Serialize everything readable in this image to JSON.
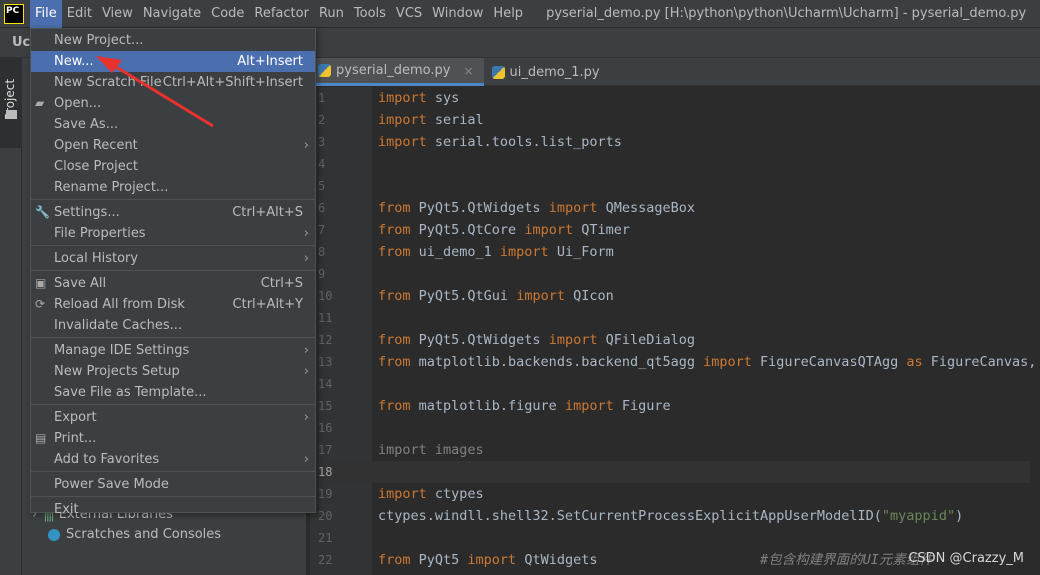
{
  "menubar": {
    "logo": "PC",
    "items": [
      "File",
      "Edit",
      "View",
      "Navigate",
      "Code",
      "Refactor",
      "Run",
      "Tools",
      "VCS",
      "Window",
      "Help"
    ],
    "window_title": "pyserial_demo.py [H:\\python\\python\\Ucharm\\Ucharm] - pyserial_demo.py"
  },
  "toolbar": {
    "project_title": "Uc"
  },
  "strip": {
    "project_tab": "Project"
  },
  "panel": {
    "external_libraries": "External Libraries",
    "scratches": "Scratches and Consoles"
  },
  "file_menu": [
    {
      "label": "New Project..."
    },
    {
      "label": "New...",
      "shortcut": "Alt+Insert",
      "highlighted": true
    },
    {
      "label": "New Scratch File",
      "shortcut": "Ctrl+Alt+Shift+Insert"
    },
    {
      "label": "Open...",
      "icon": "folder-open-icon"
    },
    {
      "label": "Save As..."
    },
    {
      "label": "Open Recent",
      "submenu": true
    },
    {
      "label": "Close Project"
    },
    {
      "label": "Rename Project...",
      "sep_after": true
    },
    {
      "label": "Settings...",
      "shortcut": "Ctrl+Alt+S",
      "icon": "wrench-icon"
    },
    {
      "label": "File Properties",
      "submenu": true,
      "sep_after": true
    },
    {
      "label": "Local History",
      "submenu": true,
      "sep_after": true
    },
    {
      "label": "Save All",
      "shortcut": "Ctrl+S",
      "icon": "save-icon"
    },
    {
      "label": "Reload All from Disk",
      "shortcut": "Ctrl+Alt+Y",
      "icon": "reload-icon"
    },
    {
      "label": "Invalidate Caches...",
      "sep_after": true
    },
    {
      "label": "Manage IDE Settings",
      "submenu": true
    },
    {
      "label": "New Projects Setup",
      "submenu": true
    },
    {
      "label": "Save File as Template...",
      "sep_after": true
    },
    {
      "label": "Export",
      "submenu": true
    },
    {
      "label": "Print...",
      "icon": "print-icon"
    },
    {
      "label": "Add to Favorites",
      "submenu": true,
      "sep_after": true
    },
    {
      "label": "Power Save Mode",
      "sep_after": true
    },
    {
      "label": "Exit"
    }
  ],
  "tabs": [
    {
      "label": "pyserial_demo.py",
      "active": true
    },
    {
      "label": "ui_demo_1.py"
    }
  ],
  "code": {
    "current_line": 18,
    "lines": [
      [
        [
          "import",
          "kw"
        ],
        [
          " sys",
          ""
        ]
      ],
      [
        [
          "import",
          "kw"
        ],
        [
          " serial",
          ""
        ]
      ],
      [
        [
          "import",
          "kw"
        ],
        [
          " serial.tools.list_ports",
          ""
        ]
      ],
      [],
      [],
      [
        [
          "from",
          "kw"
        ],
        [
          " PyQt5.QtWidgets ",
          ""
        ],
        [
          "import",
          "kw"
        ],
        [
          " QMessageBox",
          ""
        ]
      ],
      [
        [
          "from",
          "kw"
        ],
        [
          " PyQt5.QtCore ",
          ""
        ],
        [
          "import",
          "kw"
        ],
        [
          " QTimer",
          ""
        ]
      ],
      [
        [
          "from",
          "kw"
        ],
        [
          " ui_demo_1 ",
          ""
        ],
        [
          "import",
          "kw"
        ],
        [
          " Ui_Form",
          ""
        ]
      ],
      [],
      [
        [
          "from",
          "kw"
        ],
        [
          " PyQt5.QtGui ",
          ""
        ],
        [
          "import",
          "kw"
        ],
        [
          " QIcon",
          ""
        ]
      ],
      [],
      [
        [
          "from",
          "kw"
        ],
        [
          " PyQt5.QtWidgets ",
          ""
        ],
        [
          "import",
          "kw"
        ],
        [
          " QFileDialog",
          ""
        ]
      ],
      [
        [
          "from",
          "kw"
        ],
        [
          " matplotlib.backends.backend_qt5agg ",
          ""
        ],
        [
          "import",
          "kw"
        ],
        [
          " FigureCanvasQTAgg ",
          ""
        ],
        [
          "as",
          "kw"
        ],
        [
          " FigureCanvas, N",
          ""
        ]
      ],
      [],
      [
        [
          "from",
          "kw"
        ],
        [
          " matplotlib.figure ",
          ""
        ],
        [
          "import",
          "kw"
        ],
        [
          " Figure",
          ""
        ]
      ],
      [],
      [
        [
          "import images",
          "dim"
        ]
      ],
      [],
      [
        [
          "import",
          "kw"
        ],
        [
          " ctypes",
          ""
        ]
      ],
      [
        [
          "ctypes.windll.shell32.SetCurrentProcessExplicitAppUserModelID(",
          ""
        ],
        [
          "\"myappid\"",
          "str"
        ],
        [
          ")",
          ""
        ]
      ],
      [],
      [
        [
          "from",
          "kw"
        ],
        [
          " PyQt5 ",
          ""
        ],
        [
          "import",
          "kw"
        ],
        [
          " QtWidgets",
          ""
        ],
        [
          "                    #包含构建界面的UI元素组件",
          "cm"
        ]
      ]
    ]
  },
  "watermark": "CSDN @Crazzy_M",
  "colors": {
    "menu_highlight": "#4b6eaf",
    "keyword": "#cc7832",
    "string": "#6a8759",
    "annotation_arrow": "#e8322e"
  }
}
